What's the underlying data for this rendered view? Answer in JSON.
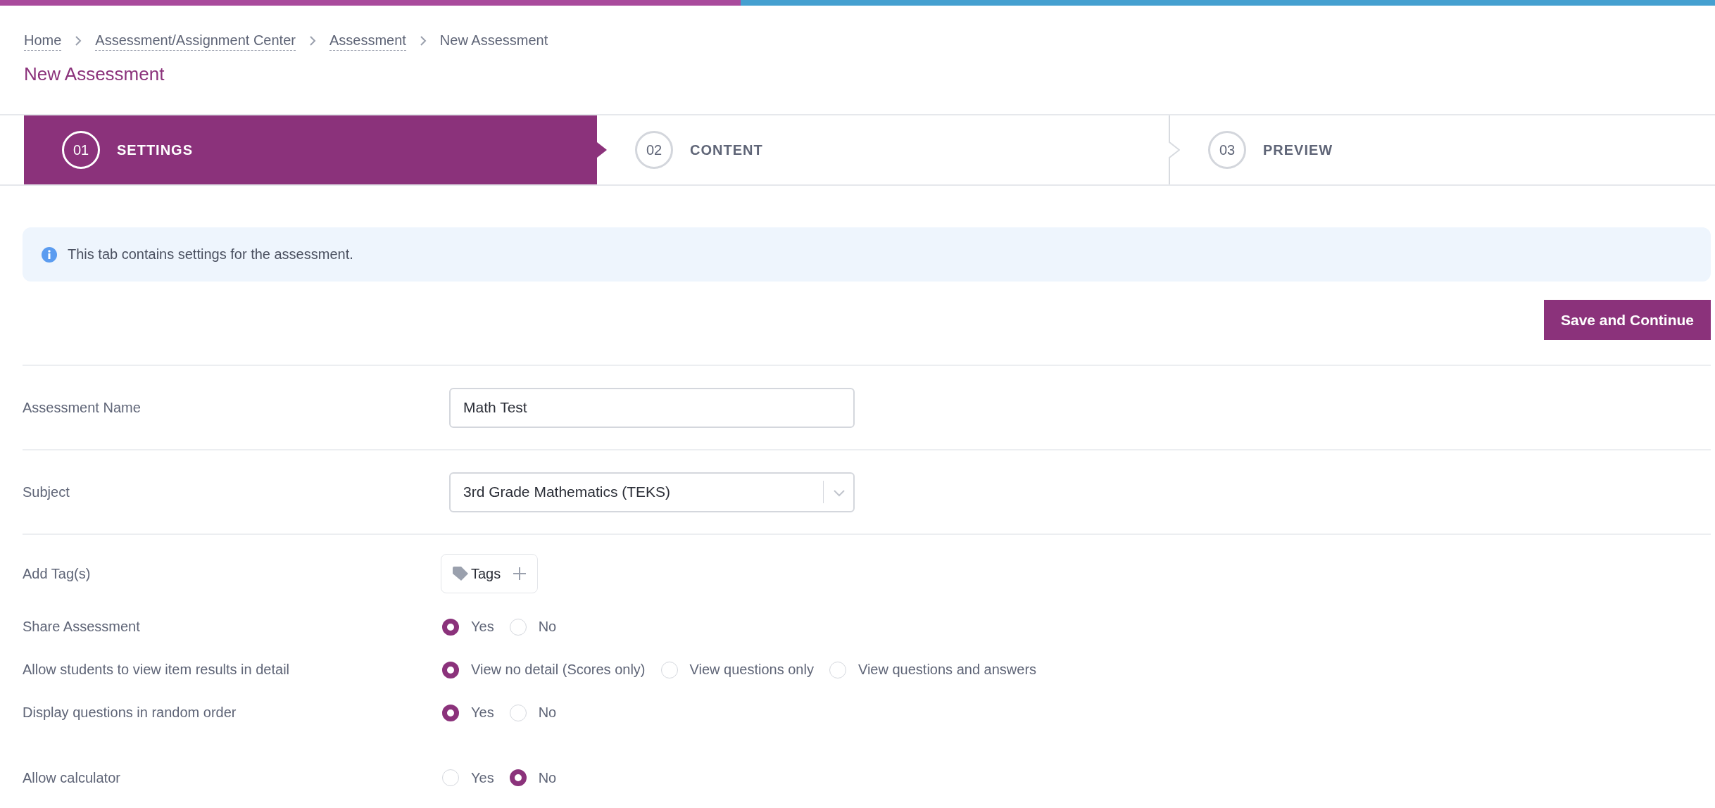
{
  "breadcrumbs": [
    {
      "label": "Home",
      "current": false
    },
    {
      "label": "Assessment/Assignment Center",
      "current": false
    },
    {
      "label": "Assessment",
      "current": false
    },
    {
      "label": "New Assessment",
      "current": true
    }
  ],
  "page_title": "New Assessment",
  "steps": [
    {
      "number": "01",
      "label": "SETTINGS",
      "selected": true
    },
    {
      "number": "02",
      "label": "CONTENT",
      "selected": false
    },
    {
      "number": "03",
      "label": "PREVIEW",
      "selected": false
    }
  ],
  "info": {
    "text": "This tab contains settings for the assessment."
  },
  "save_button": "Save and Continue",
  "fields": [
    {
      "kind": "text",
      "label": "Assessment Name",
      "value": "Math Test"
    },
    {
      "kind": "select",
      "label": "Subject",
      "value": "3rd Grade Mathematics (TEKS)"
    },
    {
      "kind": "tags",
      "label": "Add Tag(s)",
      "button": "Tags"
    },
    {
      "kind": "radio",
      "label": "Share Assessment",
      "options": [
        {
          "label": "Yes",
          "selected": true
        },
        {
          "label": "No",
          "selected": false
        }
      ]
    },
    {
      "kind": "radio",
      "label": "Allow students to view item results in detail",
      "options": [
        {
          "label": "View no detail (Scores only)",
          "selected": true
        },
        {
          "label": "View questions only",
          "selected": false
        },
        {
          "label": "View questions and answers",
          "selected": false
        }
      ]
    },
    {
      "kind": "radio",
      "label": "Display questions in random order",
      "options": [
        {
          "label": "Yes",
          "selected": true
        },
        {
          "label": "No",
          "selected": false
        }
      ]
    },
    {
      "kind": "radio",
      "label": "Allow calculator",
      "options": [
        {
          "label": "Yes",
          "selected": false
        },
        {
          "label": "No",
          "selected": true
        }
      ]
    }
  ]
}
